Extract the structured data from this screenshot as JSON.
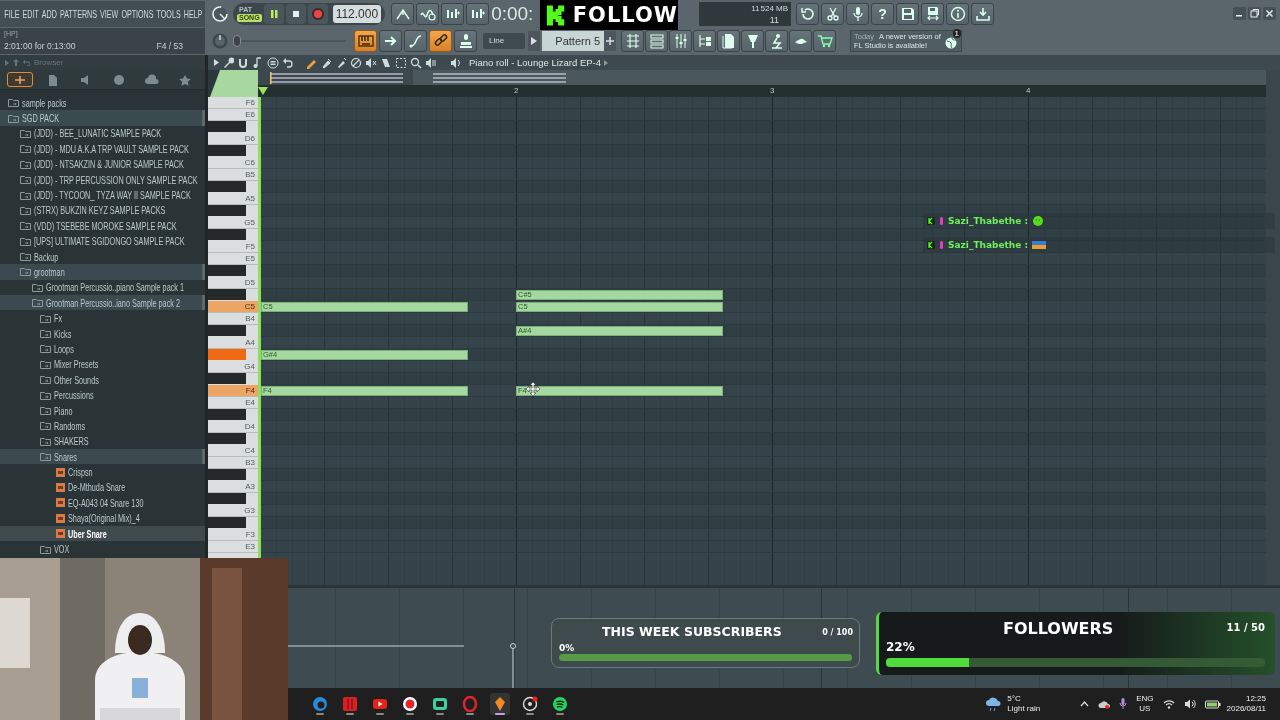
{
  "toolbar": {
    "menu": [
      "FILE",
      "EDIT",
      "ADD",
      "PATTERNS",
      "VIEW",
      "OPTIONS",
      "TOOLS",
      "HELP"
    ],
    "hint_panel": {
      "label": "[HP]",
      "text": "2:01:00 for 0:13:00",
      "position": "F4 / 53"
    },
    "modes": [
      {
        "label": "PAT",
        "selected": false
      },
      {
        "label": "SONG",
        "selected": true
      }
    ],
    "tempo": "112.000",
    "time": "0:00:",
    "monitor": {
      "cpu": "11",
      "memory": "524 MB",
      "polyphony": "11"
    },
    "help": "?",
    "pitch_slider": {
      "level": 0
    },
    "snap_tools": [
      {
        "on": true
      },
      {
        "on": false
      },
      {
        "on": false
      },
      {
        "on": true
      },
      {
        "on": false
      }
    ],
    "snap": "Line",
    "pattern": "Pattern 5",
    "news": {
      "date": "Today",
      "text": "A newer version of FL Studio is available!",
      "count": "1"
    }
  },
  "browser": {
    "title": "Browser",
    "tabs": [
      {
        "selected": true
      },
      {
        "selected": false
      },
      {
        "selected": false
      },
      {
        "selected": false
      },
      {
        "selected": false
      },
      {
        "selected": false
      }
    ],
    "items": [
      {
        "label": "sample packs",
        "kind": "folder",
        "expanded": false,
        "selected": false
      },
      {
        "label": "SGD PACK",
        "kind": "folder",
        "expanded": true,
        "selected": false,
        "children": [
          {
            "label": "(JDD) - BEE_LUNATIC SAMPLE PACK",
            "kind": "folder",
            "expanded": false,
            "selected": false
          },
          {
            "label": "(JDD) - MDU A.K.A TRP VAULT SAMPLE PACK",
            "kind": "folder",
            "expanded": false,
            "selected": false
          },
          {
            "label": "(JDD) - NTSAKZIN & JUNIOR SAMPLE PACK",
            "kind": "folder",
            "expanded": false,
            "selected": false
          },
          {
            "label": "(JDD) - TRP PERCUSSION ONLY SAMPLE PACK",
            "kind": "folder",
            "expanded": false,
            "selected": false
          },
          {
            "label": "(JDD) - TYCOON_ TYZA WAY II SAMPLE PACK",
            "kind": "folder",
            "expanded": false,
            "selected": false
          },
          {
            "label": "(STRX) BUKZIN KEYZ SAMPLE PACKS",
            "kind": "folder",
            "expanded": false,
            "selected": false
          },
          {
            "label": "(VDD) TSEBEBE MOROKE SAMPLE PACK",
            "kind": "folder",
            "expanded": false,
            "selected": false
          },
          {
            "label": "[UPS] ULTIMATE SGIDONGO SAMPLE PACK",
            "kind": "folder",
            "expanded": false,
            "selected": false
          },
          {
            "label": "Backup",
            "kind": "folder",
            "expanded": false,
            "selected": false
          },
          {
            "label": "grootman",
            "kind": "folder",
            "expanded": true,
            "selected": false,
            "children": [
              {
                "label": "Grootman Percussio..piano Sample pack 1",
                "kind": "folder",
                "expanded": false,
                "selected": false
              },
              {
                "label": "Grootman Percussio..iano Sample pack 2",
                "kind": "folder",
                "expanded": true,
                "selected": false,
                "children": [
                  {
                    "label": "Fx",
                    "kind": "folder",
                    "expanded": false,
                    "selected": false
                  },
                  {
                    "label": "Kicks",
                    "kind": "folder",
                    "expanded": false,
                    "selected": false
                  },
                  {
                    "label": "Loops",
                    "kind": "folder",
                    "expanded": false,
                    "selected": false
                  },
                  {
                    "label": "Mixer Presets",
                    "kind": "folder",
                    "expanded": false,
                    "selected": false
                  },
                  {
                    "label": "Other Sounds",
                    "kind": "folder",
                    "expanded": false,
                    "selected": false
                  },
                  {
                    "label": "Percussions",
                    "kind": "folder",
                    "expanded": false,
                    "selected": false
                  },
                  {
                    "label": "Piano",
                    "kind": "folder",
                    "expanded": false,
                    "selected": false
                  },
                  {
                    "label": "Randoms",
                    "kind": "folder",
                    "expanded": false,
                    "selected": false
                  },
                  {
                    "label": "SHAKERS",
                    "kind": "folder",
                    "expanded": false,
                    "selected": false
                  },
                  {
                    "label": "Snares",
                    "kind": "folder",
                    "expanded": true,
                    "selected": false,
                    "children": [
                      {
                        "label": "Crispsn",
                        "kind": "file",
                        "selected": false
                      },
                      {
                        "label": "De-Mthuda Snare",
                        "kind": "file",
                        "selected": false
                      },
                      {
                        "label": "EQ-A043 04 Snare 130",
                        "kind": "file",
                        "selected": false
                      },
                      {
                        "label": "Shaya(Original Mix)_4",
                        "kind": "file",
                        "selected": false
                      },
                      {
                        "label": "Uber Snare",
                        "kind": "file",
                        "selected": true
                      }
                    ]
                  },
                  {
                    "label": "VOX",
                    "kind": "folder",
                    "expanded": false,
                    "selected": false
                  }
                ]
              }
            ]
          }
        ]
      }
    ]
  },
  "piano_roll": {
    "title": "Piano roll - Lounge Lizard EP-4",
    "bars": [
      "2",
      "3",
      "4"
    ],
    "keys": [
      {
        "kind": "white",
        "label": "F6",
        "pressed": false
      },
      {
        "kind": "white",
        "label": "E6",
        "pressed": false
      },
      {
        "kind": "black",
        "pressed": false
      },
      {
        "kind": "white",
        "label": "D6",
        "pressed": false
      },
      {
        "kind": "black",
        "pressed": false
      },
      {
        "kind": "white",
        "label": "C6",
        "pressed": false
      },
      {
        "kind": "white",
        "label": "B5",
        "pressed": false
      },
      {
        "kind": "black",
        "pressed": false
      },
      {
        "kind": "white",
        "label": "A5",
        "pressed": false
      },
      {
        "kind": "black",
        "pressed": false
      },
      {
        "kind": "white",
        "label": "G5",
        "pressed": false
      },
      {
        "kind": "black",
        "pressed": false
      },
      {
        "kind": "white",
        "label": "F5",
        "pressed": false
      },
      {
        "kind": "white",
        "label": "E5",
        "pressed": false
      },
      {
        "kind": "black",
        "pressed": false
      },
      {
        "kind": "white",
        "label": "D5",
        "pressed": false
      },
      {
        "kind": "black",
        "pressed": false
      },
      {
        "kind": "white",
        "label": "C5",
        "pressed": true
      },
      {
        "kind": "white",
        "label": "B4",
        "pressed": false
      },
      {
        "kind": "black",
        "pressed": false
      },
      {
        "kind": "white",
        "label": "A4",
        "pressed": false
      },
      {
        "kind": "black",
        "pressed": true
      },
      {
        "kind": "white",
        "label": "G4",
        "pressed": false
      },
      {
        "kind": "black",
        "pressed": false
      },
      {
        "kind": "white",
        "label": "F4",
        "pressed": true
      },
      {
        "kind": "white",
        "label": "E4",
        "pressed": false
      },
      {
        "kind": "black",
        "pressed": false
      },
      {
        "kind": "white",
        "label": "D4",
        "pressed": false
      },
      {
        "kind": "black",
        "pressed": false
      },
      {
        "kind": "white",
        "label": "C4",
        "pressed": false
      },
      {
        "kind": "white",
        "label": "B3",
        "pressed": false
      },
      {
        "kind": "black",
        "pressed": false
      },
      {
        "kind": "white",
        "label": "A3",
        "pressed": false
      },
      {
        "kind": "black",
        "pressed": false
      },
      {
        "kind": "white",
        "label": "G3",
        "pressed": false
      },
      {
        "kind": "black",
        "pressed": false
      },
      {
        "kind": "white",
        "label": "F3",
        "pressed": false
      },
      {
        "kind": "white",
        "label": "E3",
        "pressed": false
      }
    ],
    "notes": [
      {
        "label": "C5"
      },
      {
        "label": "G#4"
      },
      {
        "label": "F4"
      },
      {
        "label": "C#5"
      },
      {
        "label": "C5"
      },
      {
        "label": "A#4"
      },
      {
        "label": "F4"
      }
    ]
  },
  "chat": [
    {
      "user": "Sazi_Thabethe :"
    },
    {
      "user": "Sazi_Thabethe :"
    }
  ],
  "stream_overlay": {
    "follow_banner": "FOLLOW",
    "goals": [
      {
        "title": "THIS WEEK SUBSCRIBERS",
        "count": "0 / 100",
        "percent": "0%",
        "level": 0
      },
      {
        "title": "FOLLOWERS",
        "count": "11 / 50",
        "percent": "22%",
        "level": 0.22
      }
    ]
  },
  "taskbar": {
    "apps": [
      {
        "selected": false
      },
      {
        "selected": false
      },
      {
        "selected": false
      },
      {
        "selected": false
      },
      {
        "selected": false
      },
      {
        "selected": false
      },
      {
        "selected": true
      },
      {
        "selected": false
      },
      {
        "selected": false
      }
    ],
    "weather": {
      "temperature": "5°C",
      "text": "Light rain"
    },
    "language": "ENG",
    "region": "US",
    "time": "12:25",
    "date": "2026/08/11"
  }
}
